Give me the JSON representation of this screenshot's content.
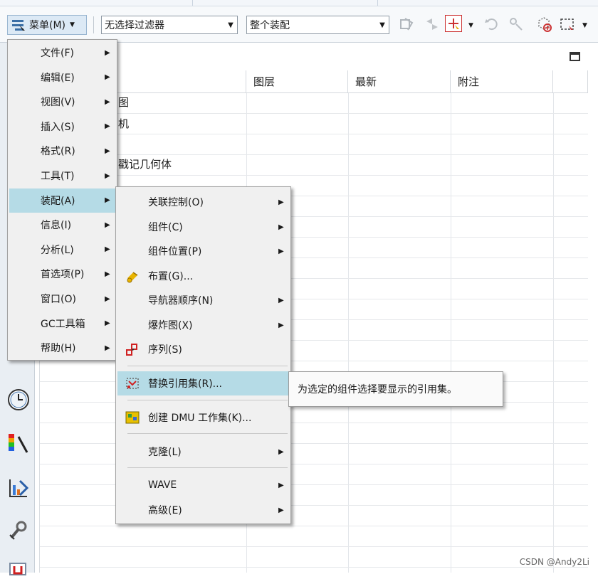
{
  "toolbar": {
    "menu_label": "菜单(M)",
    "filter_value": "无选择过滤器",
    "scope_value": "整个装配"
  },
  "table": {
    "columns": [
      "图层",
      "最新",
      "附注"
    ],
    "row_fragments": [
      "图",
      "机",
      "戳记几何体"
    ]
  },
  "main_menu": {
    "items": [
      {
        "label": "文件(F)",
        "has_sub": true
      },
      {
        "label": "编辑(E)",
        "has_sub": true
      },
      {
        "label": "视图(V)",
        "has_sub": true
      },
      {
        "label": "插入(S)",
        "has_sub": true
      },
      {
        "label": "格式(R)",
        "has_sub": true
      },
      {
        "label": "工具(T)",
        "has_sub": true
      },
      {
        "label": "装配(A)",
        "has_sub": true,
        "highlighted": true
      },
      {
        "label": "信息(I)",
        "has_sub": true
      },
      {
        "label": "分析(L)",
        "has_sub": true
      },
      {
        "label": "首选项(P)",
        "has_sub": true
      },
      {
        "label": "窗口(O)",
        "has_sub": true
      },
      {
        "label": "GC工具箱",
        "has_sub": true
      },
      {
        "label": "帮助(H)",
        "has_sub": true
      }
    ]
  },
  "assembly_menu": {
    "items": [
      {
        "label": "关联控制(O)",
        "has_sub": true,
        "icon": ""
      },
      {
        "label": "组件(C)",
        "has_sub": true,
        "icon": ""
      },
      {
        "label": "组件位置(P)",
        "has_sub": true,
        "icon": ""
      },
      {
        "label": "布置(G)...",
        "has_sub": false,
        "icon": "arrangement-icon"
      },
      {
        "label": "导航器顺序(N)",
        "has_sub": true,
        "icon": ""
      },
      {
        "label": "爆炸图(X)",
        "has_sub": true,
        "icon": ""
      },
      {
        "label": "序列(S)",
        "has_sub": false,
        "icon": "sequence-icon"
      },
      {
        "label": "替换引用集(R)...",
        "has_sub": false,
        "icon": "replace-reference-set-icon",
        "highlighted": true
      },
      {
        "label": "创建 DMU 工作集(K)...",
        "has_sub": false,
        "icon": "dmu-workset-icon"
      },
      {
        "label": "克隆(L)",
        "has_sub": true,
        "icon": ""
      },
      {
        "label": "WAVE",
        "has_sub": true,
        "icon": ""
      },
      {
        "label": "高级(E)",
        "has_sub": true,
        "icon": ""
      }
    ]
  },
  "tooltip": "为选定的组件选择要显示的引用集。",
  "watermark": "CSDN @Andy2Li",
  "left_icons": [
    "clock-icon",
    "color-palette-icon",
    "bar-chart-icon",
    "tool-icon",
    "document-icon"
  ],
  "colors": {
    "highlight": "#b5dbe6",
    "menu_bg": "#f0f0f0",
    "toolbar_btn": "#dce9f5"
  }
}
